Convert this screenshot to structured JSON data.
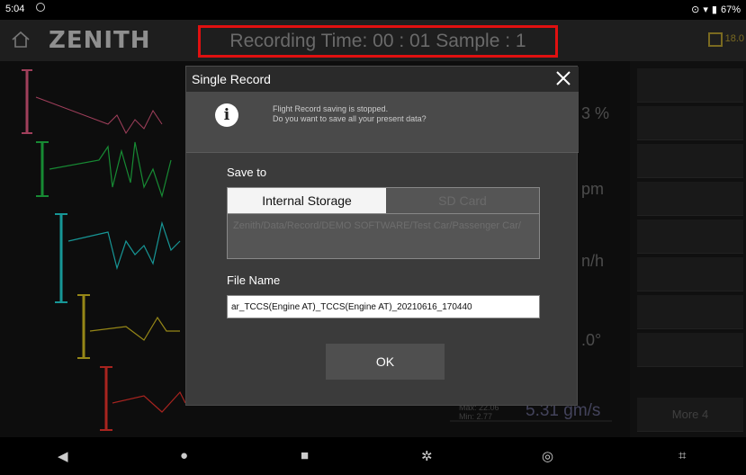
{
  "status": {
    "time": "5:04",
    "battery": "67%"
  },
  "header": {
    "logo": "ZENITH",
    "recording_text": "Recording Time: 00 : 01 Sample : 1",
    "calendar_text": "18.0"
  },
  "graph": {
    "values": [
      "3 %",
      "pm",
      "n/h",
      ".0°"
    ],
    "main_value": "5.31 gm/s",
    "max_label": "Max: 22.06",
    "min_label": "Min: 2.77"
  },
  "right_panel": {
    "more_label": "More 4"
  },
  "dialog": {
    "title": "Single Record",
    "message_line1": "Flight Record saving is stopped.",
    "message_line2": "Do you want to save all your present data?",
    "save_to_label": "Save to",
    "tabs": [
      "Internal Storage",
      "SD Card"
    ],
    "path": "Zenith/Data/Record/DEMO SOFTWARE/Test Car/Passenger Car/",
    "file_name_label": "File Name",
    "file_name_value": "ar_TCCS(Engine AT)_TCCS(Engine AT)_20210616_170440",
    "ok_label": "OK"
  },
  "colors": {
    "record_highlight": "#e01010",
    "series": [
      "#d6547a",
      "#1fb845",
      "#1fc8c8",
      "#c8b41f",
      "#e0302a"
    ]
  }
}
